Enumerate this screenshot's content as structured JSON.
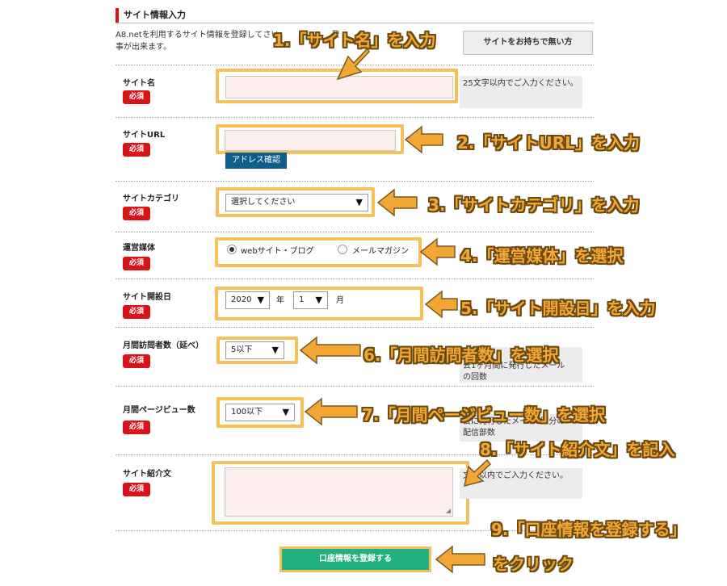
{
  "section": {
    "title": "サイト情報入力",
    "intro": "A8.netを利用するサイト情報を登録してさい。　　　　　　登\n事が出来ます。",
    "no_site_button": "サイトをお持ちで無い方"
  },
  "required_label": "必須",
  "fields": {
    "site_name": {
      "label": "サイト名",
      "hint": "25文字以内でご入力ください。"
    },
    "site_url": {
      "label": "サイトURL",
      "address_check_button": "アドレス確認"
    },
    "site_category": {
      "label": "サイトカテゴリ",
      "select_value": "選択してください"
    },
    "media": {
      "label": "運営媒体",
      "options": [
        "webサイト・ブログ",
        "メールマガジン"
      ],
      "selected": "webサイト・ブログ"
    },
    "open_date": {
      "label": "サイト開設日",
      "year": "2020",
      "year_unit": "年",
      "month": "1",
      "month_unit": "月"
    },
    "monthly_visitors": {
      "label": "月間訪問者数（延べ）",
      "select_value": "5以下",
      "hint": "場\n去1ヶ月間に発行したメール\nの回数"
    },
    "monthly_pageviews": {
      "label": "月間ページビュー数",
      "select_value": "100以下",
      "hint": "去に発行したメール1回分の\n配信部数"
    },
    "site_intro": {
      "label": "サイト紹介文",
      "hint": "文字以内でご入力ください。"
    }
  },
  "submit_button": "口座情報を登録する",
  "annotations": {
    "a1": "1.「サイト名」を入力",
    "a2": "2.「サイトURL」を入力",
    "a3": "3.「サイトカテゴリ」を入力",
    "a4": "4.「運営媒体」を選択",
    "a5": "5.「サイト開設日」を入力",
    "a6": "6.「月間訪問者数」を選択",
    "a7": "7.「月間ページビュー数」を選択",
    "a8": "8.「サイト紹介文」を記入",
    "a9_line1": "9.「口座情報を登録する」",
    "a9_line2": "をクリック"
  },
  "colors": {
    "required": "#d7141a",
    "highlight": "#f7c15a",
    "annotation": "#f2a735",
    "submit": "#21b07f",
    "link_button": "#0e5e8a"
  }
}
